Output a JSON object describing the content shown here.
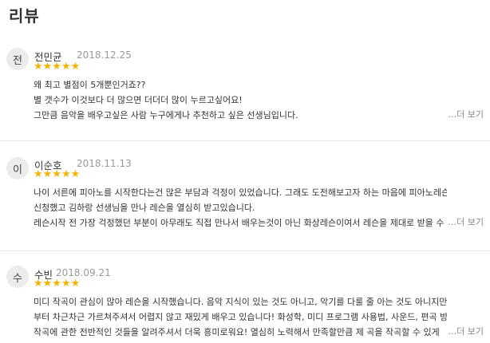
{
  "section": {
    "title": "리뷰"
  },
  "reviews": [
    {
      "avatar": "전",
      "name": "전민균",
      "date": "2018.12.25",
      "stars": "★★★★★",
      "lines": [
        "왜 최고 별점이 5개뿐인거죠??",
        "별 갯수가 이것보다 더 많으면 더더더 많이 누르고싶어요!",
        "그만큼 음악을 배우고싶은 사람 누구에게나 추천하고 싶은 선생님입니다."
      ],
      "more": "…더 보기"
    },
    {
      "avatar": "이",
      "name": "이순호",
      "date": "2018.11.13",
      "stars": "★★★★★",
      "lines": [
        "나이 서른에 피아노를 시작한다는건 많은 부담과 걱정이 있었습니다. 그래도 도전해보고자 하는 마음에 피아노레슨을",
        "신청했고 김하랑 선생님을 만나 레슨을 열심히 받고있습니다.",
        "레슨시작 전 가장 걱정했던 부분이 아무래도 직접 만나서 배우는것이 아닌 화상레슨이여서 레슨을 제대로 받을 수"
      ],
      "more": "…더 보기"
    },
    {
      "avatar": "수",
      "name": "수빈",
      "date": "2018.09.21",
      "stars": "★★★★★",
      "lines": [
        "미디 작곡이 관심이 많아 레슨을 시작했습니다. 음악 지식이 있는 것도 아니고, 악기를 다룰 줄 아는 것도 아니지만, 기초",
        "부터 차근차근 가르쳐주셔서 어렵지 않고 재밌게 배우고 있습니다! 화성학, 미디 프로그램 사용법, 사운드, 편곡 방식 등",
        "작곡에 관한 전반적인 것들을 알려주셔서 더욱 흥미로워요! 열심히 노력해서 만족할만큼 제 곡을 작곡할 수 있게"
      ],
      "more": "…더 보기"
    }
  ]
}
